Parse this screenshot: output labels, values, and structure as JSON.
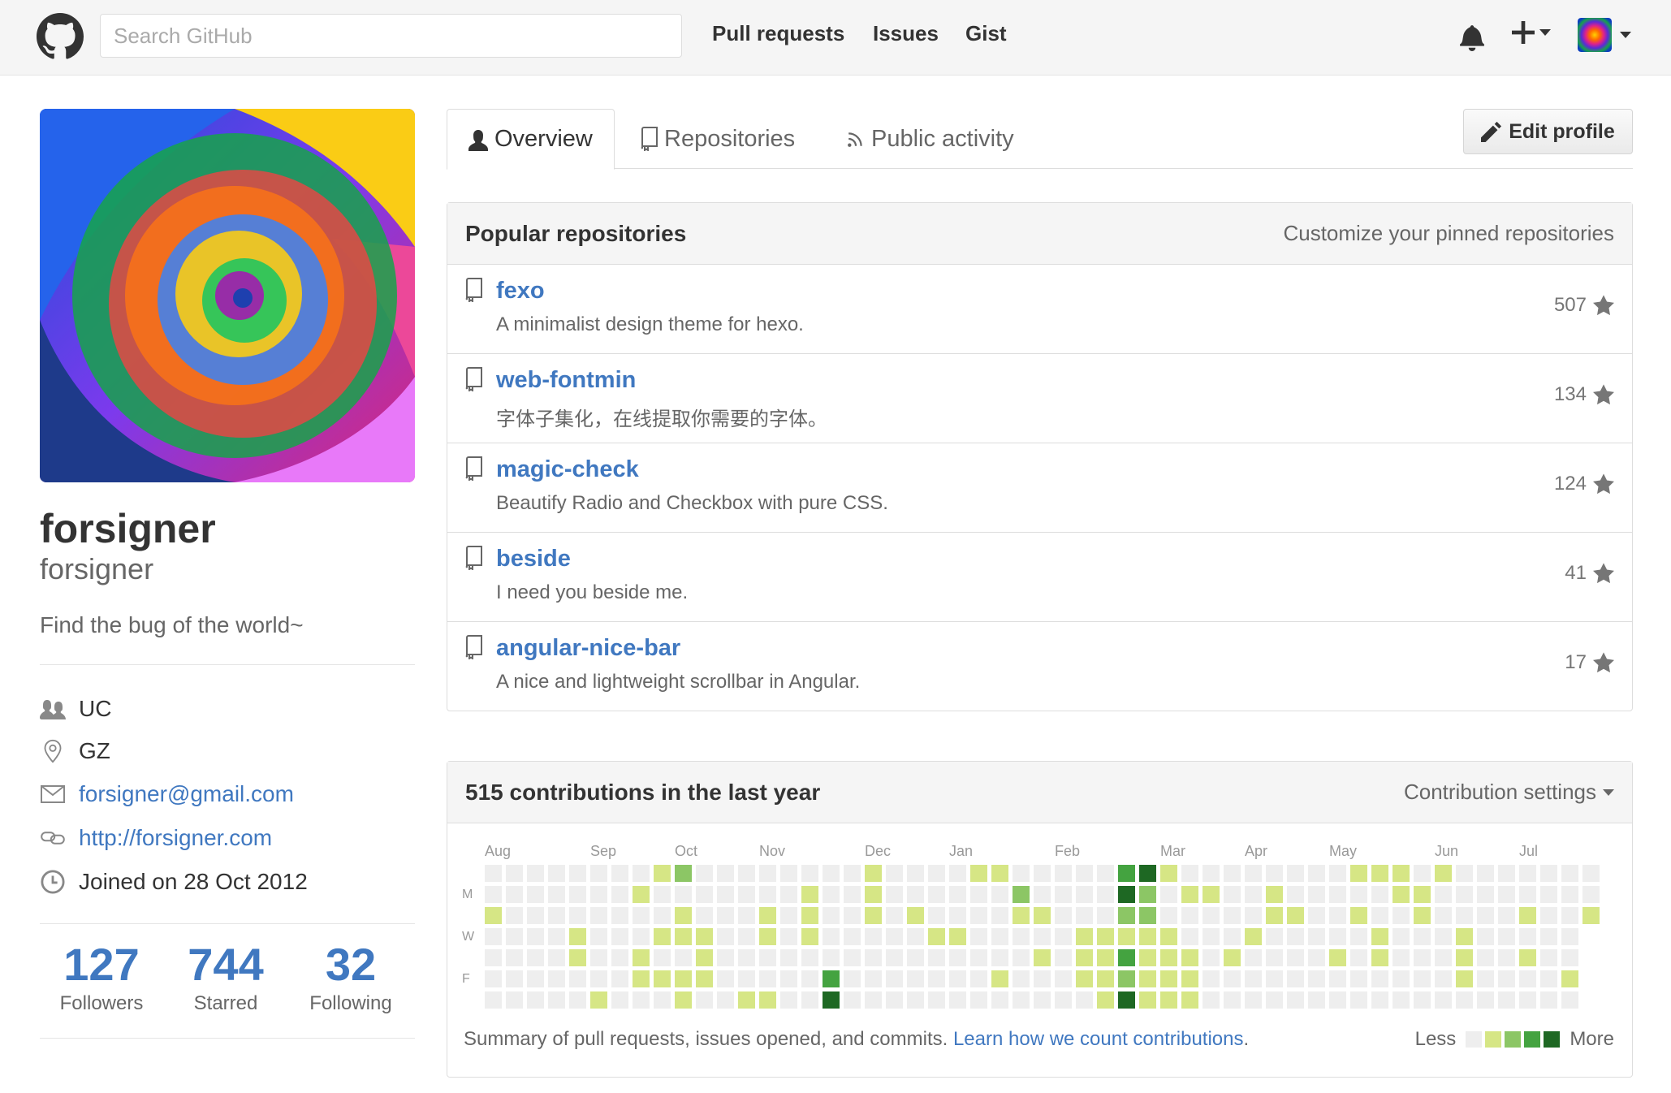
{
  "header": {
    "search_placeholder": "Search GitHub",
    "nav": [
      "Pull requests",
      "Issues",
      "Gist"
    ],
    "icons": [
      "octocat-logo-icon",
      "bell-icon",
      "plus-icon",
      "avatar-icon"
    ]
  },
  "profile": {
    "fullname": "forsigner",
    "username": "forsigner",
    "bio": "Find the bug of the world~",
    "details": {
      "organization": "UC",
      "location": "GZ",
      "email": "forsigner@gmail.com",
      "website": "http://forsigner.com",
      "joined": "Joined on 28 Oct 2012"
    },
    "stats": [
      {
        "value": "127",
        "label": "Followers"
      },
      {
        "value": "744",
        "label": "Starred"
      },
      {
        "value": "32",
        "label": "Following"
      }
    ]
  },
  "tabs": [
    "Overview",
    "Repositories",
    "Public activity"
  ],
  "edit_profile_label": "Edit profile",
  "popular": {
    "title": "Popular repositories",
    "customize": "Customize your pinned repositories",
    "repos": [
      {
        "name": "fexo",
        "desc": "A minimalist design theme for hexo.",
        "stars": "507"
      },
      {
        "name": "web-fontmin",
        "desc": "字体子集化，在线提取你需要的字体。",
        "stars": "134"
      },
      {
        "name": "magic-check",
        "desc": "Beautify Radio and Checkbox with pure CSS.",
        "stars": "124"
      },
      {
        "name": "beside",
        "desc": "I need you beside me.",
        "stars": "41"
      },
      {
        "name": "angular-nice-bar",
        "desc": "A nice and lightweight scrollbar in Angular.",
        "stars": "17"
      }
    ]
  },
  "contributions": {
    "title": "515 contributions in the last year",
    "settings": "Contribution settings",
    "months": [
      "Aug",
      "Sep",
      "Oct",
      "Nov",
      "Dec",
      "Jan",
      "Feb",
      "Mar",
      "Apr",
      "May",
      "Jun",
      "Jul"
    ],
    "weekdays": [
      "M",
      "W",
      "F"
    ],
    "summary": "Summary of pull requests, issues opened, and commits.",
    "learn_link": "Learn how we count contributions",
    "period": ".",
    "legend_less": "Less",
    "legend_more": "More",
    "colors": [
      "#eeeeee",
      "#d6e685",
      "#8cc665",
      "#44a340",
      "#1e6823"
    ],
    "active_cells": [
      [
        0,
        2,
        1
      ],
      [
        4,
        3,
        1
      ],
      [
        4,
        4,
        1
      ],
      [
        5,
        6,
        1
      ],
      [
        7,
        1,
        1
      ],
      [
        7,
        4,
        1
      ],
      [
        7,
        5,
        1
      ],
      [
        8,
        0,
        1
      ],
      [
        8,
        3,
        1
      ],
      [
        8,
        5,
        1
      ],
      [
        9,
        0,
        2
      ],
      [
        9,
        2,
        1
      ],
      [
        9,
        3,
        1
      ],
      [
        9,
        5,
        1
      ],
      [
        9,
        6,
        1
      ],
      [
        10,
        3,
        1
      ],
      [
        10,
        4,
        1
      ],
      [
        10,
        5,
        1
      ],
      [
        12,
        6,
        1
      ],
      [
        13,
        2,
        1
      ],
      [
        13,
        3,
        1
      ],
      [
        13,
        6,
        1
      ],
      [
        15,
        1,
        1
      ],
      [
        15,
        2,
        1
      ],
      [
        15,
        3,
        1
      ],
      [
        16,
        5,
        3
      ],
      [
        16,
        6,
        4
      ],
      [
        18,
        0,
        1
      ],
      [
        18,
        1,
        1
      ],
      [
        18,
        2,
        1
      ],
      [
        20,
        2,
        1
      ],
      [
        21,
        3,
        1
      ],
      [
        22,
        3,
        1
      ],
      [
        23,
        0,
        1
      ],
      [
        24,
        0,
        1
      ],
      [
        24,
        5,
        1
      ],
      [
        25,
        1,
        2
      ],
      [
        25,
        2,
        1
      ],
      [
        26,
        2,
        1
      ],
      [
        26,
        4,
        1
      ],
      [
        28,
        3,
        1
      ],
      [
        28,
        4,
        1
      ],
      [
        28,
        5,
        1
      ],
      [
        29,
        3,
        1
      ],
      [
        29,
        4,
        1
      ],
      [
        29,
        5,
        1
      ],
      [
        29,
        6,
        1
      ],
      [
        30,
        0,
        3
      ],
      [
        30,
        1,
        4
      ],
      [
        30,
        2,
        2
      ],
      [
        30,
        3,
        1
      ],
      [
        30,
        4,
        3
      ],
      [
        30,
        5,
        2
      ],
      [
        30,
        6,
        4
      ],
      [
        31,
        0,
        4
      ],
      [
        31,
        1,
        2
      ],
      [
        31,
        2,
        2
      ],
      [
        31,
        3,
        1
      ],
      [
        31,
        4,
        1
      ],
      [
        31,
        5,
        1
      ],
      [
        31,
        6,
        1
      ],
      [
        32,
        0,
        1
      ],
      [
        32,
        3,
        1
      ],
      [
        32,
        4,
        1
      ],
      [
        32,
        5,
        1
      ],
      [
        32,
        6,
        1
      ],
      [
        33,
        1,
        1
      ],
      [
        33,
        4,
        1
      ],
      [
        33,
        5,
        1
      ],
      [
        33,
        6,
        1
      ],
      [
        34,
        1,
        1
      ],
      [
        35,
        4,
        1
      ],
      [
        36,
        3,
        1
      ],
      [
        37,
        1,
        1
      ],
      [
        37,
        2,
        1
      ],
      [
        38,
        2,
        1
      ],
      [
        40,
        4,
        1
      ],
      [
        41,
        0,
        1
      ],
      [
        41,
        2,
        1
      ],
      [
        42,
        0,
        1
      ],
      [
        42,
        3,
        1
      ],
      [
        42,
        4,
        1
      ],
      [
        43,
        0,
        1
      ],
      [
        43,
        1,
        1
      ],
      [
        44,
        1,
        1
      ],
      [
        44,
        2,
        1
      ],
      [
        45,
        0,
        1
      ],
      [
        46,
        3,
        1
      ],
      [
        46,
        4,
        1
      ],
      [
        46,
        5,
        1
      ],
      [
        49,
        2,
        1
      ],
      [
        49,
        4,
        1
      ],
      [
        51,
        5,
        1
      ],
      [
        52,
        2,
        1
      ]
    ]
  }
}
